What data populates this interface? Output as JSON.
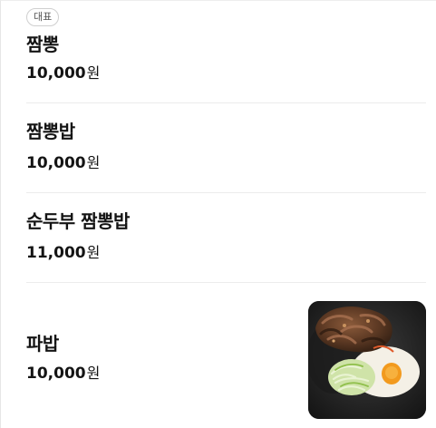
{
  "menu": {
    "items": [
      {
        "badge": "대표",
        "name": "짬뽕",
        "price": "10,000",
        "currency": "원"
      },
      {
        "name": "짬뽕밥",
        "price": "10,000",
        "currency": "원"
      },
      {
        "name": "순두부 짬뽕밥",
        "price": "11,000",
        "currency": "원"
      },
      {
        "name": "파밥",
        "price": "10,000",
        "currency": "원"
      }
    ]
  }
}
